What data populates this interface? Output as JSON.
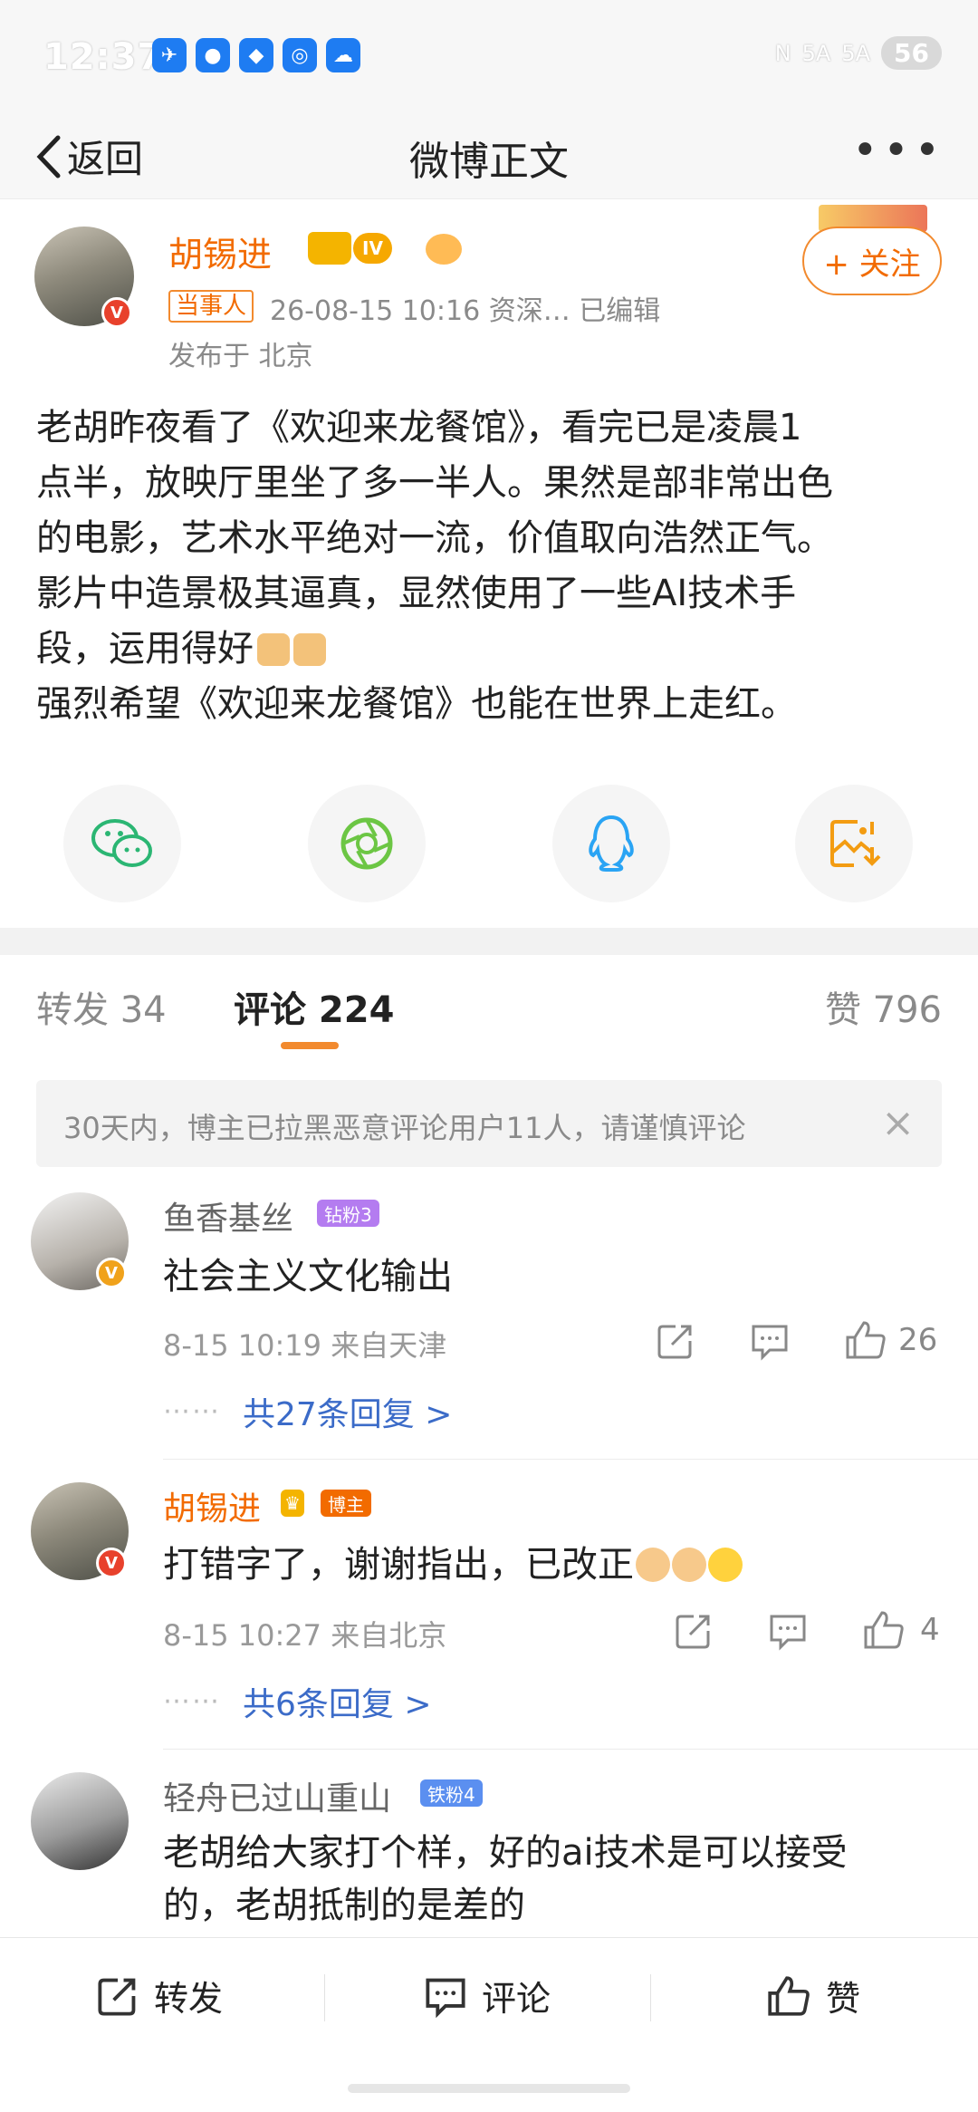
{
  "status_bar": {
    "time": "12:37",
    "signal_text_1": "5A",
    "signal_text_2": "5A",
    "battery": "56",
    "app_icons": [
      "chat-icon",
      "message-icon",
      "shield-icon",
      "bulb-icon",
      "weather-icon"
    ]
  },
  "nav": {
    "back_label": "返回",
    "title": "微博正文",
    "more_label": "•••"
  },
  "post": {
    "author": "胡锡进",
    "level_badge": "IV",
    "tag": "当事人",
    "meta": "26-08-15 10:16  资深…     已编辑",
    "location": "发布于 北京",
    "follow_label": "+ 关注",
    "body_lines": [
      "老胡昨夜看了《欢迎来龙餐馆》，看完已是凌晨1",
      "点半，放映厅里坐了多一半人。果然是部非常出色",
      "的电影，艺术水平绝对一流，价值取向浩然正气。",
      "影片中造景极其逼真，显然使用了一些AI技术手",
      "段，运用得好"
    ],
    "body_last": "强烈希望《欢迎来龙餐馆》也能在世界上走红。"
  },
  "share": [
    "wechat-icon",
    "moments-icon",
    "qq-icon",
    "save-image-icon"
  ],
  "tabs": {
    "repost": "转发 34",
    "comment": "评论 224",
    "like": "赞 796"
  },
  "notice": {
    "text": "30天内，博主已拉黑恶意评论用户11人，请谨慎评论",
    "close": "×"
  },
  "comments": [
    {
      "name": "鱼香基丝",
      "badge": "钻粉3",
      "text": "社会主义文化输出",
      "meta": "8-15 10:19 来自天津",
      "likes": "26",
      "replies": "共27条回复 >"
    },
    {
      "name": "胡锡进",
      "badge": "博主",
      "text": "打错字了，谢谢指出，已改正",
      "meta": "8-15 10:27 来自北京",
      "likes": "4",
      "replies": "共6条回复 >"
    },
    {
      "name": "轻舟已过山重山",
      "badge": "铁粉4",
      "text_lines": [
        "老胡给大家打个样，好的ai技术是可以接受",
        "的，老胡抵制的是差的"
      ]
    }
  ],
  "dots": "⋯⋯",
  "bottom_bar": {
    "repost": "转发",
    "comment": "评论",
    "like": "赞"
  },
  "colors": {
    "accent": "#f26b00",
    "link": "#3b6bc8",
    "tab_underline": "#f28a2e"
  }
}
